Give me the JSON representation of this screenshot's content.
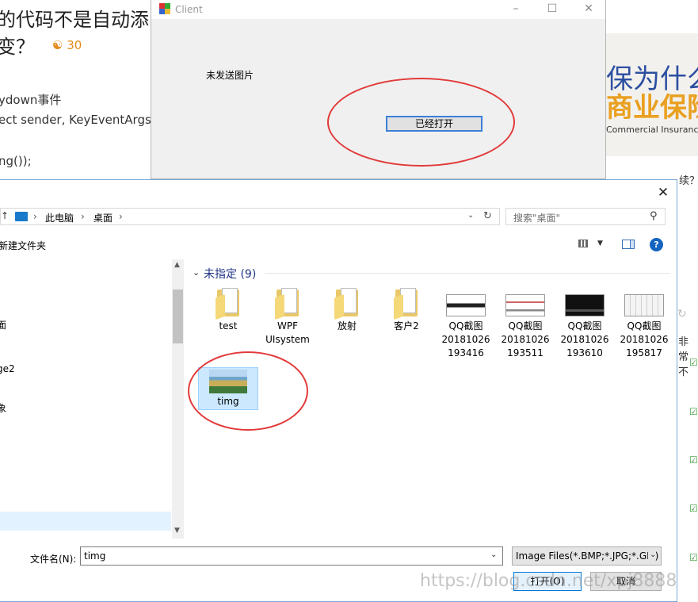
{
  "background_page": {
    "title_line1": "的代码不是自动添",
    "title_line2": "变？",
    "coin_count": "30",
    "code_lines": [
      "ydown事件",
      "ect sender, KeyEventArgs e",
      "ng());"
    ],
    "ad": {
      "line1": "保为什么",
      "line2": "商业保险",
      "line3": "Commercial Insurance"
    },
    "side_text_1": "续？",
    "side_text_2": "非常不"
  },
  "client_window": {
    "title": "Client",
    "label": "未发送图片",
    "button": "已经打开"
  },
  "file_dialog": {
    "breadcrumb": [
      "此电脑",
      "桌面"
    ],
    "search_placeholder": "搜索\"桌面\"",
    "new_folder": "新建文件夹",
    "nav_items": [
      "面",
      "ge2",
      "象"
    ],
    "group_title": "未指定 (9)",
    "files": [
      {
        "name": "test",
        "kind": "folder"
      },
      {
        "name": "WPF\nUIsystem",
        "kind": "folder"
      },
      {
        "name": "放射",
        "kind": "folder"
      },
      {
        "name": "客户2",
        "kind": "folder"
      },
      {
        "name": "QQ截图\n20181026\n193416",
        "kind": "image"
      },
      {
        "name": "QQ截图\n20181026\n193511",
        "kind": "image"
      },
      {
        "name": "QQ截图\n20181026\n193610",
        "kind": "image"
      },
      {
        "name": "QQ截图\n20181026\n195817",
        "kind": "image"
      },
      {
        "name": "timg",
        "kind": "image",
        "selected": true
      }
    ],
    "filename_label": "文件名(N):",
    "filename_value": "timg",
    "filter_value": "Image Files(*.BMP;*.JPG;*.GIF)",
    "open_button": "打开(O)",
    "cancel_button": "取消"
  },
  "watermark": "https://blog.csdn.net/xpj8888",
  "colors": {
    "annotation_red": "#e23a3a",
    "selection_blue": "#cce8ff",
    "accent": "#0078d7"
  }
}
